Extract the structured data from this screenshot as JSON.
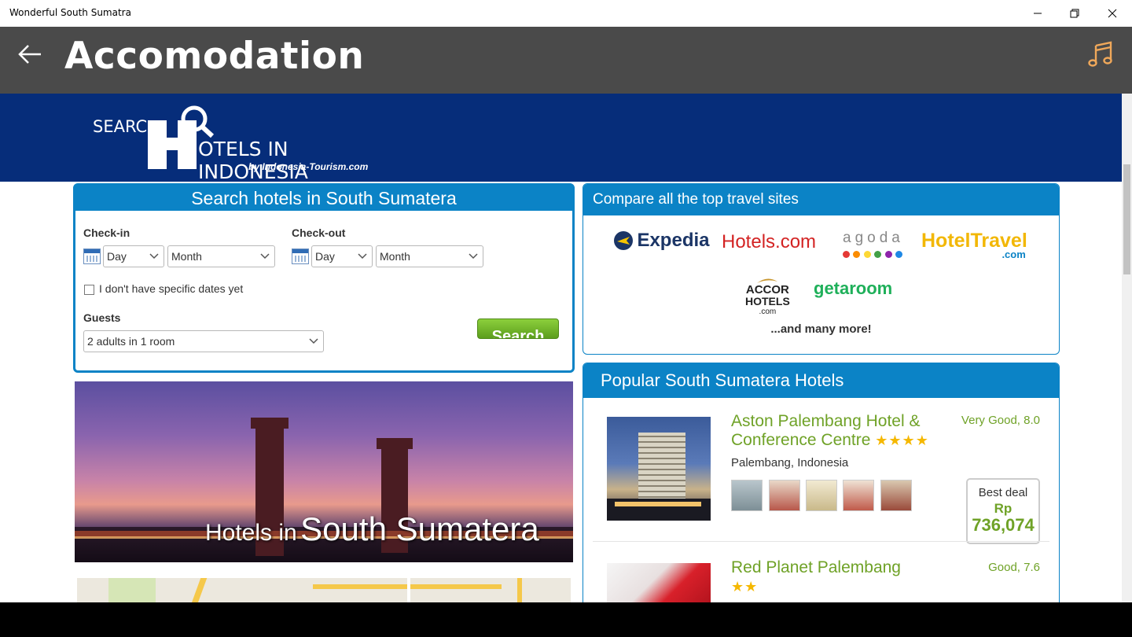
{
  "window": {
    "title": "Wonderful South Sumatra"
  },
  "appbar": {
    "title": "Accomodation"
  },
  "banner": {
    "logo_text_top": "SEARC",
    "logo_text_main": "OTELS IN INDONESIA",
    "logo_text_by": "by Indonesia-Tourism.com"
  },
  "search": {
    "heading": "Search hotels in South Sumatera",
    "checkin_label": "Check-in",
    "checkout_label": "Check-out",
    "day_placeholder": "Day",
    "month_placeholder": "Month",
    "no_dates_label": "I don't have specific dates yet",
    "guests_label": "Guests",
    "guests_value": "2 adults in 1 room",
    "search_button": "Search"
  },
  "photo": {
    "caption_small": "Hotels in",
    "caption_big": "South Sumatera"
  },
  "compare": {
    "heading": "Compare all the top travel sites",
    "partners": {
      "expedia": "Expedia",
      "hotels": "Hotels.com",
      "agoda": "agoda",
      "hoteltravel": "HotelTravel",
      "hoteltravel_sub": ".com",
      "accor_1": "ACCOR",
      "accor_2": "HOTELS",
      "accor_3": ".com",
      "getaroom": "getaroom"
    },
    "more": "...and many more!"
  },
  "popular": {
    "heading": "Popular South Sumatera Hotels",
    "hotels": [
      {
        "name_line1": "Aston Palembang Hotel &",
        "name_line2": "Conference Centre",
        "stars": "★★★★",
        "rating": "Very Good, 8.0",
        "location": "Palembang, Indonesia",
        "deal_label": "Best deal",
        "deal_currency": "Rp",
        "deal_price": "736,074"
      },
      {
        "name_line1": "Red Planet Palembang",
        "stars": "★★",
        "rating": "Good, 7.6"
      }
    ]
  },
  "colors": {
    "appbar": "#4a4a4a",
    "banner": "#062d7a",
    "accent": "#0b83c6",
    "green": "#6fa227",
    "star": "#f5b800",
    "music_icon": "#f0a85a"
  }
}
